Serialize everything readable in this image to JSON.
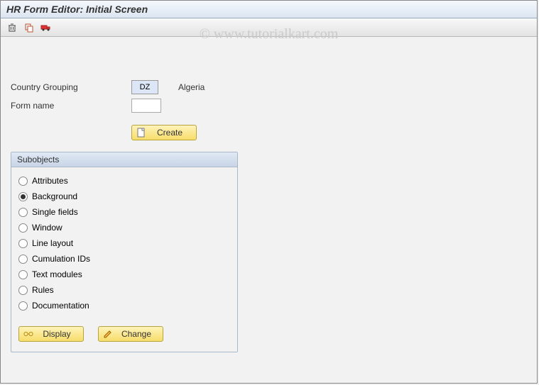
{
  "title": "HR Form Editor: Initial Screen",
  "watermark": "© www.tutorialkart.com",
  "fields": {
    "country_grouping_label": "Country Grouping",
    "country_grouping_value": "DZ",
    "country_grouping_text": "Algeria",
    "form_name_label": "Form name",
    "form_name_value": ""
  },
  "buttons": {
    "create": "Create",
    "display": "Display",
    "change": "Change"
  },
  "group": {
    "title": "Subobjects",
    "selected": "Background",
    "items": [
      "Attributes",
      "Background",
      "Single fields",
      "Window",
      "Line layout",
      "Cumulation IDs",
      "Text modules",
      "Rules",
      "Documentation"
    ]
  }
}
